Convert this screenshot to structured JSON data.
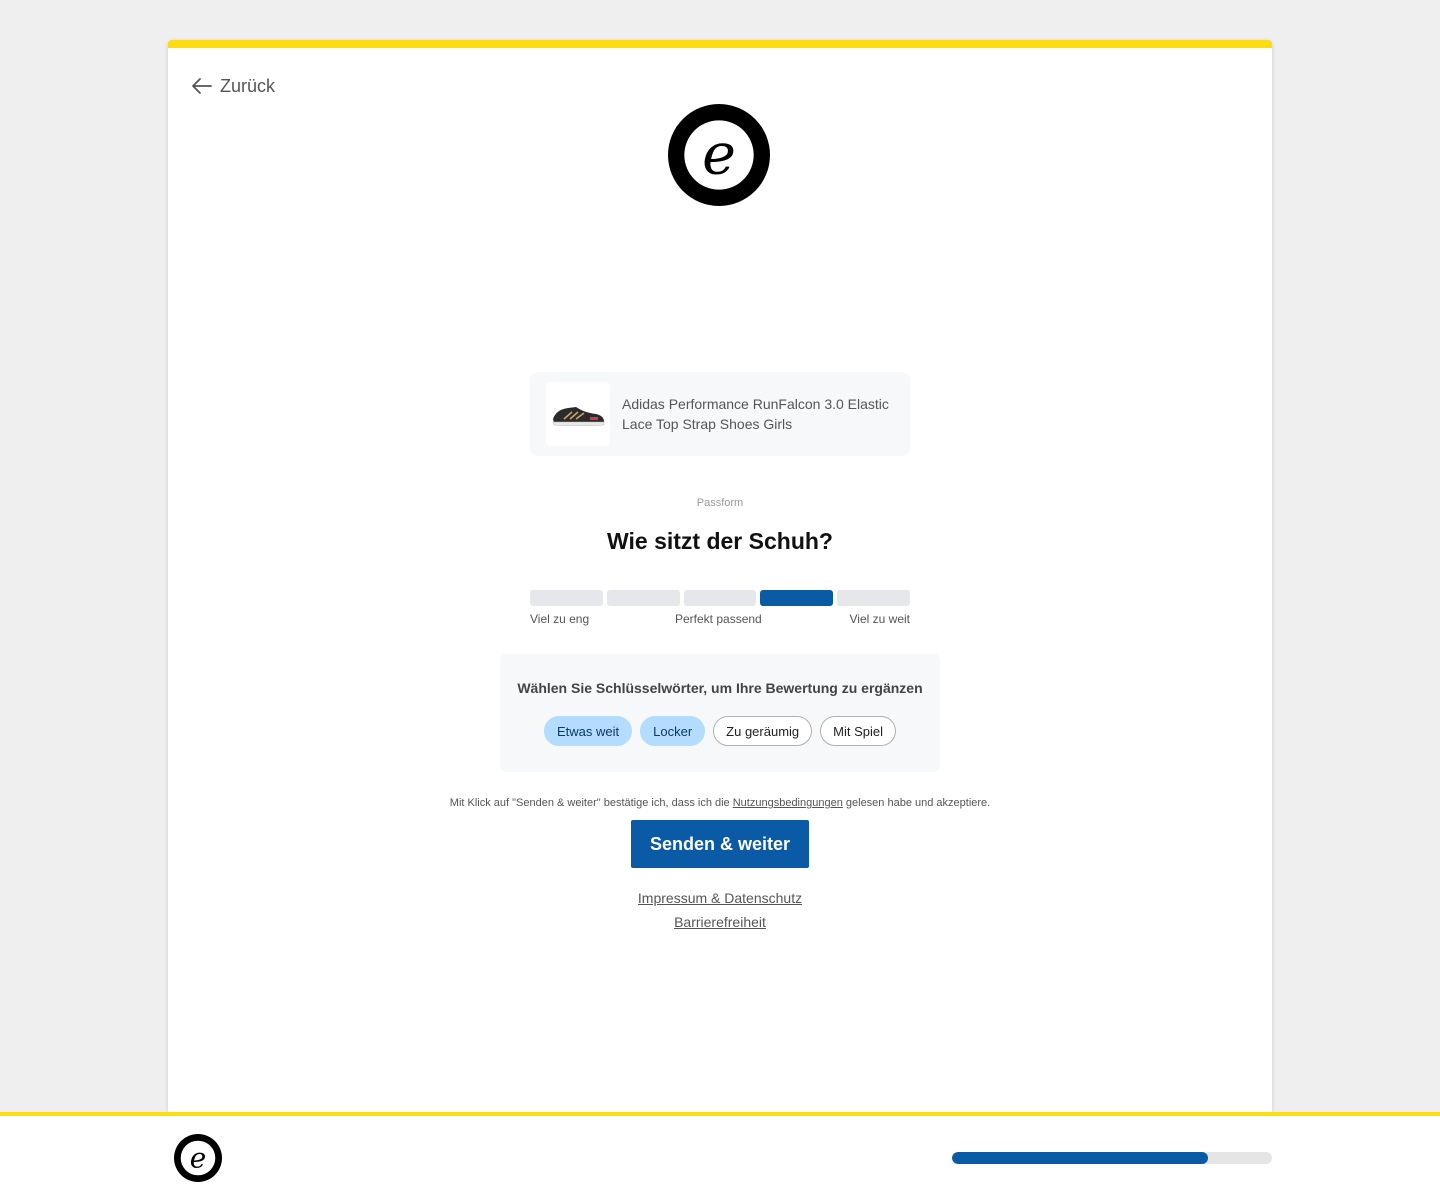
{
  "header": {
    "back_label": "Zurück"
  },
  "product": {
    "name": "Adidas Performance RunFalcon 3.0 Elastic Lace Top Strap Shoes Girls"
  },
  "rating": {
    "category": "Passform",
    "question": "Wie sitzt der Schuh?",
    "scale_segments": 5,
    "selected_segment": 4,
    "labels": {
      "left": "Viel zu eng",
      "middle": "Perfekt passend",
      "right": "Viel zu weit"
    }
  },
  "keywords": {
    "title": "Wählen Sie Schlüsselwörter, um Ihre Bewertung zu ergänzen",
    "chips": [
      {
        "label": "Etwas weit",
        "selected": true
      },
      {
        "label": "Locker",
        "selected": true
      },
      {
        "label": "Zu geräumig",
        "selected": false
      },
      {
        "label": "Mit Spiel",
        "selected": false
      }
    ]
  },
  "terms": {
    "before": "Mit Klick auf \"Senden & weiter\" bestätige ich, dass ich die ",
    "link": "Nutzungsbedingungen",
    "after": " gelesen habe und akzeptiere."
  },
  "submit_label": "Senden & weiter",
  "links": {
    "imprint": "Impressum & Datenschutz",
    "accessibility": "Barrierefreiheit"
  },
  "progress": {
    "fraction": 0.8
  },
  "colors": {
    "brand_yellow": "#ffdc0f",
    "primary_blue": "#0a5aa6",
    "chip_selected": "#b3dcff"
  },
  "icons": {
    "back": "arrow-left-icon",
    "logo": "trusted-shops-e-logo",
    "product": "sneaker-icon"
  }
}
